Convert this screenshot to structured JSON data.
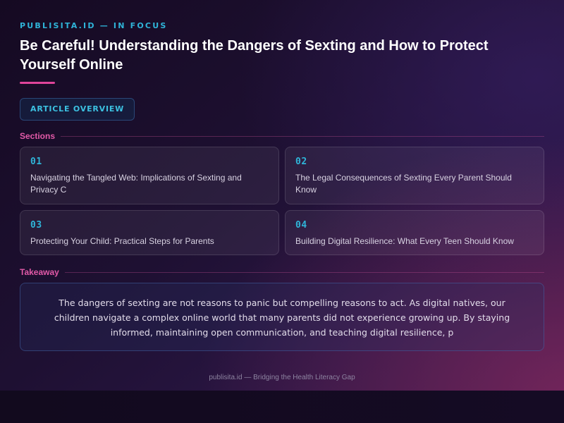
{
  "header": {
    "eyebrow": "PUBLISITA.ID — IN FOCUS",
    "title": "Be Careful! Understanding the Dangers of Sexting and How to Protect Yourself Online"
  },
  "overview_button": {
    "label": "ARTICLE OVERVIEW"
  },
  "sections": {
    "heading": "Sections",
    "items": [
      {
        "number": "01",
        "text": "Navigating the Tangled Web: Implications of Sexting and Privacy C"
      },
      {
        "number": "02",
        "text": "The Legal Consequences of Sexting Every Parent Should Know"
      },
      {
        "number": "03",
        "text": "Protecting Your Child: Practical Steps for Parents"
      },
      {
        "number": "04",
        "text": "Building Digital Resilience: What Every Teen Should Know"
      }
    ]
  },
  "takeaway": {
    "heading": "Takeaway",
    "text": "The dangers of sexting are not reasons to panic but compelling reasons to act. As digital natives, our children navigate a complex online world that many parents did not experience growing up. By staying informed, maintaining open communication, and teaching digital resilience, p"
  },
  "footer": {
    "text": "publisita.id — Bridging the Health Literacy Gap"
  },
  "colors": {
    "accent_cyan": "#2fb4d8",
    "accent_pink": "#e0449a",
    "background_dark": "#120a1e"
  }
}
